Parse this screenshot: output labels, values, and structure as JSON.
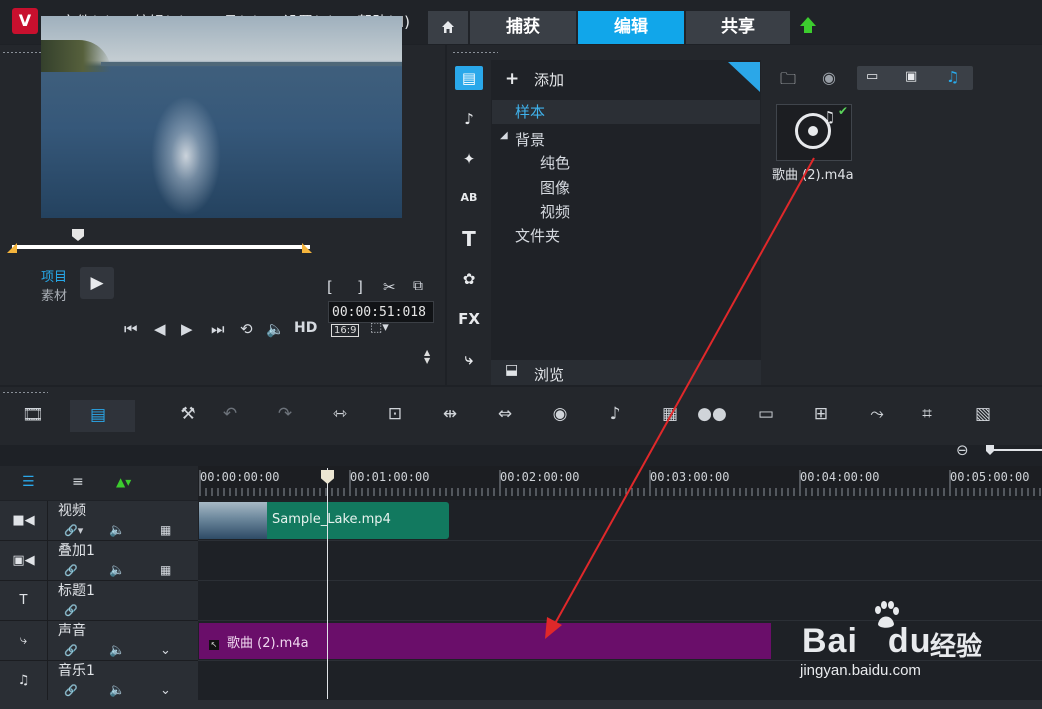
{
  "app": {
    "logo_text": "V",
    "menu": [
      "文件(F)",
      "编辑(E)",
      "工具(T)",
      "设置(S)",
      "帮助(H)"
    ],
    "tabs": {
      "capture": "捕获",
      "edit": "编辑",
      "share": "共享"
    },
    "home_icon": "home-icon",
    "upload_icon": "upload-arrow-icon"
  },
  "player": {
    "mode_project": "项目",
    "mode_clip": "素材",
    "timecode": "00:00:51:018",
    "hd_label": "HD",
    "aspect_label": "16:9",
    "playhead_position_fraction": 0.22
  },
  "library": {
    "add_label": "添加",
    "tree": {
      "sample": "样本",
      "background": "背景",
      "solid_color": "纯色",
      "image": "图像",
      "video": "视频",
      "folder": "文件夹"
    },
    "browse_label": "浏览",
    "side_icons": [
      "media-icon",
      "instant-project-icon",
      "transition-icon",
      "title-icon",
      "text-icon",
      "graphics-icon",
      "fx-icon",
      "path-icon"
    ],
    "side_fx_label": "FX",
    "side_ab_label": "AB",
    "items": [
      {
        "name": "歌曲 (2).m4a",
        "type": "audio",
        "checked": true
      }
    ]
  },
  "timeline": {
    "ruler_labels": [
      "00:00:00:00",
      "00:01:00:00",
      "00:02:00:00",
      "00:03:00:00",
      "00:04:00:00",
      "00:05:00:00"
    ],
    "tracks": [
      {
        "name": "视频",
        "icon": "video-track-icon",
        "clip": "Sample_Lake.mp4"
      },
      {
        "name": "叠加1",
        "icon": "overlay-track-icon"
      },
      {
        "name": "标题1",
        "icon": "title-track-icon"
      },
      {
        "name": "声音",
        "icon": "voice-track-icon",
        "clip": "歌曲 (2).m4a"
      },
      {
        "name": "音乐1",
        "icon": "music-track-icon"
      }
    ]
  },
  "watermark": {
    "brand": "Bai",
    "brand_du": "du",
    "cn": "经验",
    "url": "jingyan.baidu.com"
  },
  "colors": {
    "accent": "#11a6ea",
    "video_clip": "#12795f",
    "audio_clip": "#6a0e6a",
    "annotation_arrow": "#e0282a"
  }
}
